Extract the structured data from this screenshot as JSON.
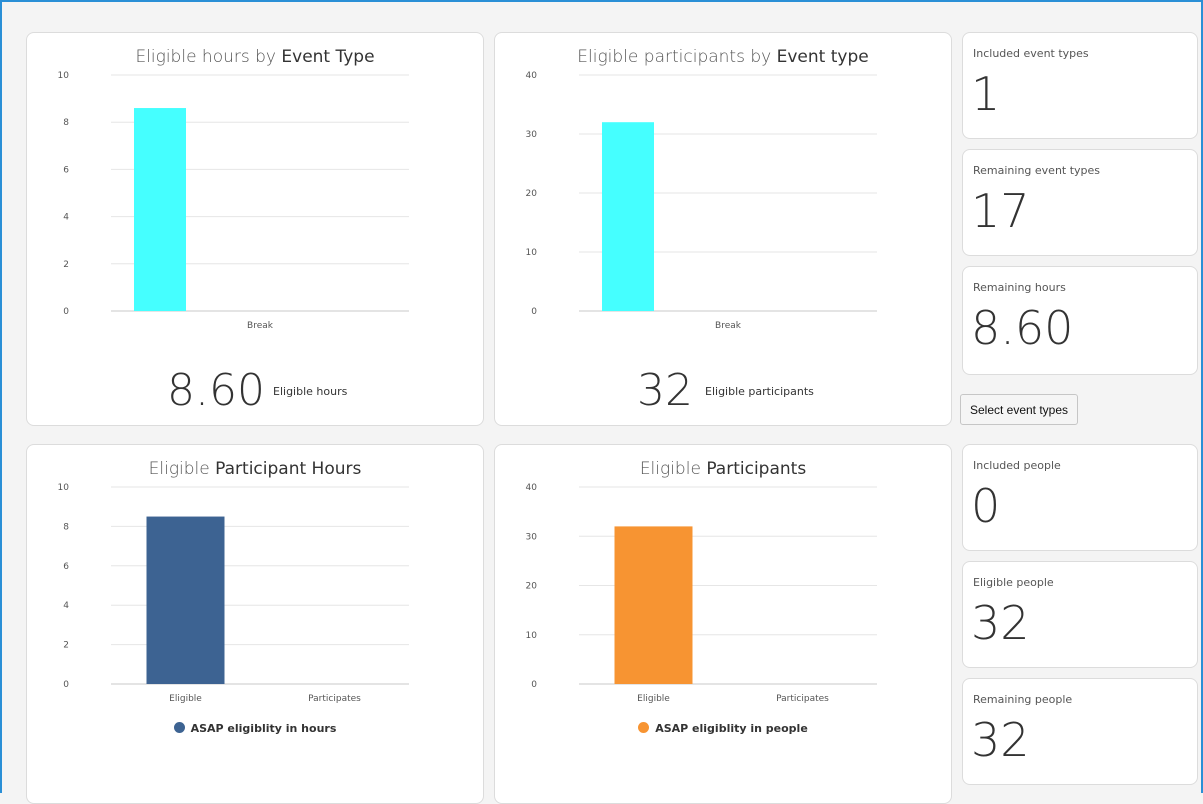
{
  "charts": [
    {
      "id": "hours-by-type",
      "title_prefix": "Eligible hours by ",
      "title_bold": "Event Type",
      "big_value": "8.60",
      "big_label": "Eligible hours",
      "legend": "",
      "color": "#45ffff"
    },
    {
      "id": "participants-by-type",
      "title_prefix": "Eligible participants by ",
      "title_bold": "Event type",
      "big_value": "32",
      "big_label": "Eligible participants",
      "legend": "",
      "color": "#45ffff"
    },
    {
      "id": "participant-hours",
      "title_prefix": "Eligible ",
      "title_bold": "Participant Hours",
      "big_value": "",
      "big_label": "",
      "legend": "ASAP eligiblity in hours",
      "color": "#3d6392"
    },
    {
      "id": "participants",
      "title_prefix": "Eligible ",
      "title_bold": "Participants",
      "big_value": "",
      "big_label": "",
      "legend": "ASAP eligiblity in people",
      "color": "#f79432"
    }
  ],
  "chart_data": [
    {
      "type": "bar",
      "title": "Eligible hours by Event Type",
      "categories": [
        "Break"
      ],
      "values": [
        8.6
      ],
      "ylim": [
        0,
        10
      ],
      "yticks": [
        0,
        2,
        4,
        6,
        8,
        10
      ],
      "grid": true
    },
    {
      "type": "bar",
      "title": "Eligible participants by Event type",
      "categories": [
        "Break"
      ],
      "values": [
        32
      ],
      "ylim": [
        0,
        40
      ],
      "yticks": [
        0,
        10,
        20,
        30,
        40
      ],
      "grid": true
    },
    {
      "type": "bar",
      "title": "Eligible Participant Hours",
      "categories": [
        "Eligible",
        "Participates"
      ],
      "series": [
        {
          "name": "ASAP eligiblity in hours",
          "values": [
            8.5,
            0
          ]
        }
      ],
      "ylim": [
        0,
        10
      ],
      "yticks": [
        0,
        2,
        4,
        6,
        8,
        10
      ],
      "grid": true,
      "legend": "bottom"
    },
    {
      "type": "bar",
      "title": "Eligible Participants",
      "categories": [
        "Eligible",
        "Participates"
      ],
      "series": [
        {
          "name": "ASAP eligiblity in people",
          "values": [
            32,
            0
          ]
        }
      ],
      "ylim": [
        0,
        40
      ],
      "yticks": [
        0,
        10,
        20,
        30,
        40
      ],
      "grid": true,
      "legend": "bottom"
    }
  ],
  "stats": {
    "included_event_types": {
      "label": "Included event types",
      "value": "1"
    },
    "remaining_event_types": {
      "label": "Remaining event types",
      "value": "17"
    },
    "remaining_hours": {
      "label": "Remaining hours",
      "value": "8.60"
    },
    "included_people": {
      "label": "Included people",
      "value": "0"
    },
    "eligible_people": {
      "label": "Eligible people",
      "value": "32"
    },
    "remaining_people": {
      "label": "Remaining people",
      "value": "32"
    }
  },
  "select_button_label": "Select event types"
}
